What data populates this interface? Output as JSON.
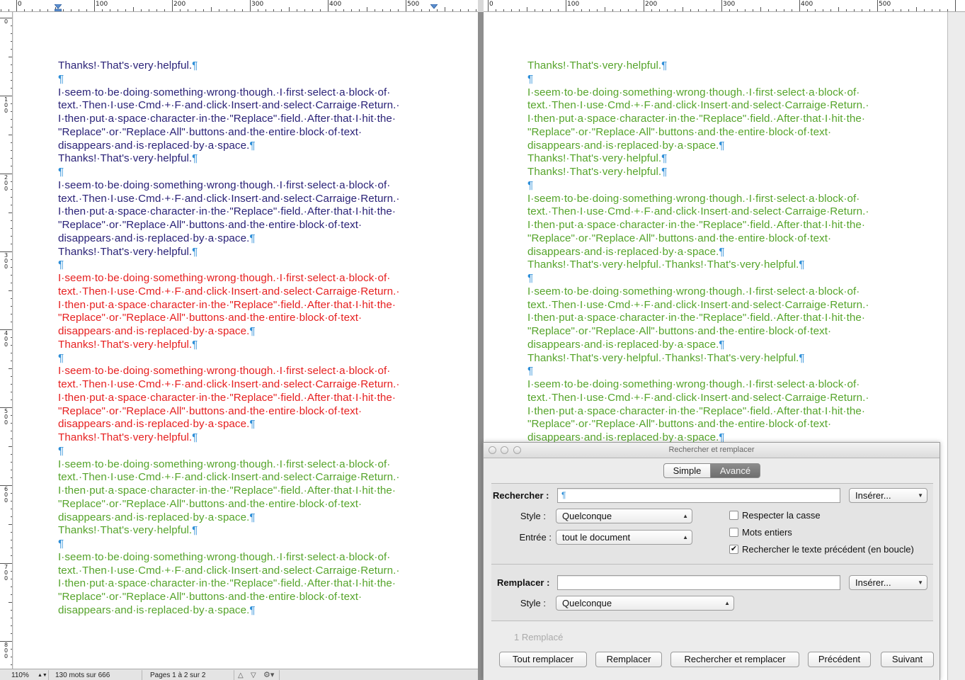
{
  "ruler": {
    "left_numbers": [
      "0",
      "100",
      "200",
      "300",
      "400",
      "500"
    ],
    "right_numbers": [
      "0",
      "100",
      "200",
      "300",
      "400",
      "500"
    ],
    "vertical_numbers": [
      "0",
      "1 0 0",
      "2 0 0",
      "3 0 0",
      "4 0 0",
      "5 0 0",
      "6 0 0",
      "7 0 0",
      "8 0 0"
    ]
  },
  "colors": {
    "navy_text": "#2a2277",
    "green_text": "#56a42b",
    "red_text": "#e62020",
    "selection": "#6ec6f3"
  },
  "document": {
    "left_page": [
      {
        "text": "Thanks!·That's·very·helpful.",
        "mark": "¶",
        "color": "navy",
        "sel": false
      },
      {
        "text": "",
        "mark": "¶",
        "color": "navy",
        "sel": false
      },
      {
        "text": "I·seem·to·be·doing·something·wrong·though.·I·first·select·a·block·of·",
        "mark": "",
        "color": "navy",
        "sel": false
      },
      {
        "text": "text.·Then·I·use·Cmd·+·F·and·click·Insert·and·select·Carraige·Return.·",
        "mark": "",
        "color": "navy",
        "sel": false
      },
      {
        "text": "I·then·put·a·space·character·in·the·\"Replace\"·field.·After·that·I·hit·the·",
        "mark": "",
        "color": "navy",
        "sel": false
      },
      {
        "text": "\"Replace\"·or·\"Replace·All\"·buttons·and·the·entire·block·of·text·",
        "mark": "",
        "color": "navy",
        "sel": false
      },
      {
        "text": "disappears·and·is·replaced·by·a·space.",
        "mark": "¶",
        "color": "navy",
        "sel": false
      },
      {
        "text": "Thanks!·That's·very·helpful.",
        "mark": "¶",
        "color": "navy",
        "sel": false
      },
      {
        "text": "",
        "mark": "¶",
        "color": "navy",
        "sel": false
      },
      {
        "text": "I·seem·to·be·doing·something·wrong·though.·I·first·select·a·block·of·",
        "mark": "",
        "color": "navy",
        "sel": false
      },
      {
        "text": "text.·Then·I·use·Cmd·+·F·and·click·Insert·and·select·Carraige·Return.·",
        "mark": "",
        "color": "navy",
        "sel": false
      },
      {
        "text": "I·then·put·a·space·character·in·the·\"Replace\"·field.·After·that·I·hit·the·",
        "mark": "",
        "color": "navy",
        "sel": false
      },
      {
        "text": "\"Replace\"·or·\"Replace·All\"·buttons·and·the·entire·block·of·text·",
        "mark": "",
        "color": "navy",
        "sel": false
      },
      {
        "text": "disappears·and·is·replaced·by·a·space.",
        "mark": "¶",
        "color": "navy",
        "sel": false
      },
      {
        "text": "Thanks!·That's·very·helpful.",
        "mark": "¶",
        "color": "navy",
        "sel": false
      },
      {
        "text": "",
        "mark": "¶",
        "color": "navy",
        "sel": false
      },
      {
        "text": "I·seem·to·be·doing·something·wrong·though.·I·first·select·a·block·of·",
        "mark": "",
        "color": "red",
        "sel": true
      },
      {
        "text": "text.·Then·I·use·Cmd·+·F·and·click·Insert·and·select·Carraige·Return.·",
        "mark": "",
        "color": "red",
        "sel": true
      },
      {
        "text": "I·then·put·a·space·character·in·the·\"Replace\"·field.·After·that·I·hit·the·",
        "mark": "",
        "color": "red",
        "sel": true
      },
      {
        "text": "\"Replace\"·or·\"Replace·All\"·buttons·and·the·entire·block·of·text·",
        "mark": "",
        "color": "red",
        "sel": true
      },
      {
        "text": "disappears·and·is·replaced·by·a·space.",
        "mark": "¶",
        "color": "red",
        "sel": true
      },
      {
        "text": "Thanks!·That's·very·helpful.",
        "mark": "¶",
        "color": "red",
        "sel": true
      },
      {
        "text": "",
        "mark": "¶",
        "color": "red",
        "sel": true
      },
      {
        "text": "I·seem·to·be·doing·something·wrong·though.·I·first·select·a·block·of·",
        "mark": "",
        "color": "red",
        "sel": true
      },
      {
        "text": "text.·Then·I·use·Cmd·+·F·and·click·Insert·and·select·Carraige·Return.·",
        "mark": "",
        "color": "red",
        "sel": true
      },
      {
        "text": "I·then·put·a·space·character·in·the·\"Replace\"·field.·After·that·I·hit·the·",
        "mark": "",
        "color": "red",
        "sel": true
      },
      {
        "text": "\"Replace\"·or·\"Replace·All\"·buttons·and·the·entire·block·of·text·",
        "mark": "",
        "color": "red",
        "sel": true
      },
      {
        "text": "disappears·and·is·replaced·by·a·space.",
        "mark": "¶",
        "color": "red",
        "sel": true
      },
      {
        "text": "Thanks!·That's·very·helpful.",
        "mark": "¶",
        "color": "red",
        "sel": true
      },
      {
        "text": "",
        "mark": "¶",
        "color": "green",
        "sel": false
      },
      {
        "text": "I·seem·to·be·doing·something·wrong·though.·I·first·select·a·block·of·",
        "mark": "",
        "color": "green",
        "sel": false
      },
      {
        "text": "text.·Then·I·use·Cmd·+·F·and·click·Insert·and·select·Carraige·Return.·",
        "mark": "",
        "color": "green",
        "sel": false
      },
      {
        "text": "I·then·put·a·space·character·in·the·\"Replace\"·field.·After·that·I·hit·the·",
        "mark": "",
        "color": "green",
        "sel": false
      },
      {
        "text": "\"Replace\"·or·\"Replace·All\"·buttons·and·the·entire·block·of·text·",
        "mark": "",
        "color": "green",
        "sel": false
      },
      {
        "text": "disappears·and·is·replaced·by·a·space.",
        "mark": "¶",
        "color": "green",
        "sel": false
      },
      {
        "text": "Thanks!·That's·very·helpful.",
        "mark": "¶",
        "color": "green",
        "sel": false
      },
      {
        "text": "",
        "mark": "¶",
        "color": "green",
        "sel": false
      },
      {
        "text": "I·seem·to·be·doing·something·wrong·though.·I·first·select·a·block·of·",
        "mark": "",
        "color": "green",
        "sel": false
      },
      {
        "text": "text.·Then·I·use·Cmd·+·F·and·click·Insert·and·select·Carraige·Return.·",
        "mark": "",
        "color": "green",
        "sel": false
      },
      {
        "text": "I·then·put·a·space·character·in·the·\"Replace\"·field.·After·that·I·hit·the·",
        "mark": "",
        "color": "green",
        "sel": false
      },
      {
        "text": "\"Replace\"·or·\"Replace·All\"·buttons·and·the·entire·block·of·text·",
        "mark": "",
        "color": "green",
        "sel": false
      },
      {
        "text": "disappears·and·is·replaced·by·a·space.",
        "mark": "¶",
        "color": "green",
        "sel": false
      }
    ],
    "right_page": [
      {
        "text": "Thanks!·That's·very·helpful.",
        "mark": "¶",
        "color": "green",
        "sel": false
      },
      {
        "text": "",
        "mark": "¶",
        "color": "green",
        "sel": false
      },
      {
        "text": "I·seem·to·be·doing·something·wrong·though.·I·first·select·a·block·of·",
        "mark": "",
        "color": "green",
        "sel": false
      },
      {
        "text": "text.·Then·I·use·Cmd·+·F·and·click·Insert·and·select·Carraige·Return.·",
        "mark": "",
        "color": "green",
        "sel": false
      },
      {
        "text": "I·then·put·a·space·character·in·the·\"Replace\"·field.·After·that·I·hit·the·",
        "mark": "",
        "color": "green",
        "sel": false
      },
      {
        "text": "\"Replace\"·or·\"Replace·All\"·buttons·and·the·entire·block·of·text·",
        "mark": "",
        "color": "green",
        "sel": false
      },
      {
        "text": "disappears·and·is·replaced·by·a·space.",
        "mark": "¶",
        "color": "green",
        "sel": false
      },
      {
        "text": "Thanks!·That's·very·helpful.",
        "mark": "¶",
        "color": "green",
        "sel": false
      },
      {
        "text": "Thanks!·That's·very·helpful.",
        "mark": "¶",
        "color": "green",
        "sel": false
      },
      {
        "text": "",
        "mark": "¶",
        "color": "green",
        "sel": false
      },
      {
        "text": "I·seem·to·be·doing·something·wrong·though.·I·first·select·a·block·of·",
        "mark": "",
        "color": "green",
        "sel": false
      },
      {
        "text": "text.·Then·I·use·Cmd·+·F·and·click·Insert·and·select·Carraige·Return.·",
        "mark": "",
        "color": "green",
        "sel": false
      },
      {
        "text": "I·then·put·a·space·character·in·the·\"Replace\"·field.·After·that·I·hit·the·",
        "mark": "",
        "color": "green",
        "sel": false
      },
      {
        "text": "\"Replace\"·or·\"Replace·All\"·buttons·and·the·entire·block·of·text·",
        "mark": "",
        "color": "green",
        "sel": false
      },
      {
        "text": "disappears·and·is·replaced·by·a·space.",
        "mark": "¶",
        "color": "green",
        "sel": false
      },
      {
        "text": "Thanks!·That's·very·helpful.·Thanks!·That's·very·helpful.",
        "mark": "¶",
        "color": "green",
        "sel": false
      },
      {
        "text": "",
        "mark": "¶",
        "color": "green",
        "sel": false
      },
      {
        "text": "I·seem·to·be·doing·something·wrong·though.·I·first·select·a·block·of·",
        "mark": "",
        "color": "green",
        "sel": false
      },
      {
        "text": "text.·Then·I·use·Cmd·+·F·and·click·Insert·and·select·Carraige·Return.·",
        "mark": "",
        "color": "green",
        "sel": false
      },
      {
        "text": "I·then·put·a·space·character·in·the·\"Replace\"·field.·After·that·I·hit·the·",
        "mark": "",
        "color": "green",
        "sel": false
      },
      {
        "text": "\"Replace\"·or·\"Replace·All\"·buttons·and·the·entire·block·of·text·",
        "mark": "",
        "color": "green",
        "sel": false
      },
      {
        "text": "disappears·and·is·replaced·by·a·space.",
        "mark": "¶",
        "color": "green",
        "sel": false
      },
      {
        "text": "Thanks!·That's·very·helpful.·Thanks!·That's·very·helpful.",
        "mark": "¶",
        "color": "green",
        "sel": false
      },
      {
        "text": "",
        "mark": "¶",
        "color": "green",
        "sel": false
      },
      {
        "text": "I·seem·to·be·doing·something·wrong·though.·I·first·select·a·block·of·",
        "mark": "",
        "color": "green",
        "sel": false
      },
      {
        "text": "text.·Then·I·use·Cmd·+·F·and·click·Insert·and·select·Carraige·Return.·",
        "mark": "",
        "color": "green",
        "sel": false
      },
      {
        "text": "I·then·put·a·space·character·in·the·\"Replace\"·field.·After·that·I·hit·the·",
        "mark": "",
        "color": "green",
        "sel": false
      },
      {
        "text": "\"Replace\"·or·\"Replace·All\"·buttons·and·the·entire·block·of·text·",
        "mark": "",
        "color": "green",
        "sel": false
      },
      {
        "text": "disappears·and·is·replaced·by·a·space.",
        "mark": "¶",
        "color": "green",
        "sel": false
      }
    ]
  },
  "statusbar": {
    "zoom": "110%",
    "word_count": "130 mots sur 666",
    "pages": "Pages 1 à 2 sur 2"
  },
  "dialog": {
    "title": "Rechercher et remplacer",
    "tabs": {
      "simple": "Simple",
      "avance": "Avancé"
    },
    "find": {
      "label": "Rechercher :",
      "value": "¶",
      "insert_label": "Insérer...",
      "style_label": "Style :",
      "style_value": "Quelconque",
      "entry_label": "Entrée :",
      "entry_value": "tout le document"
    },
    "options": {
      "match_case": {
        "label": "Respecter la casse",
        "checked": false
      },
      "whole_words": {
        "label": "Mots entiers",
        "checked": false
      },
      "wrap_search": {
        "label": "Rechercher le texte précédent (en boucle)",
        "checked": true
      }
    },
    "replace": {
      "label": "Remplacer :",
      "value": "",
      "insert_label": "Insérer...",
      "style_label": "Style :",
      "style_value": "Quelconque"
    },
    "status": "1 Remplacé",
    "buttons": {
      "replace_all": "Tout remplacer",
      "replace": "Remplacer",
      "find_replace": "Rechercher et remplacer",
      "previous": "Précédent",
      "next": "Suivant"
    }
  }
}
